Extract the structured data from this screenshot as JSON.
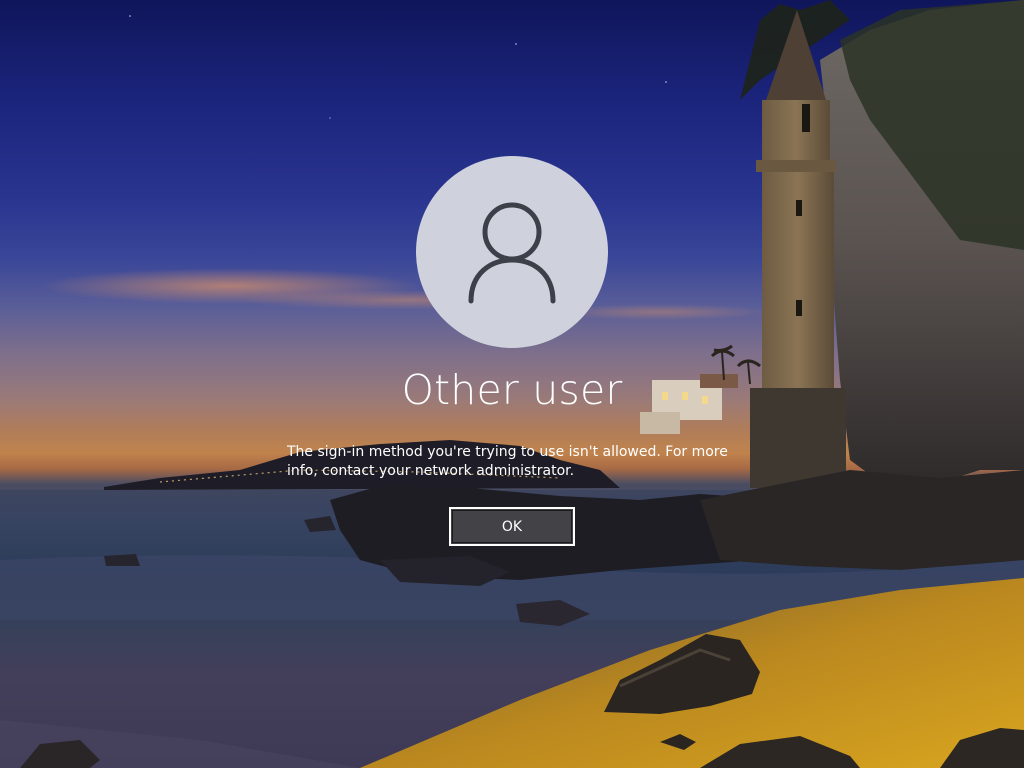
{
  "background": {
    "description_icon": "beach-castle-wallpaper"
  },
  "avatar": {
    "icon": "user-silhouette-icon"
  },
  "user": {
    "name": "Other user"
  },
  "error": {
    "message": "The sign-in method you're trying to use isn't allowed. For more info, contact your network administrator."
  },
  "buttons": {
    "ok_label": "OK"
  },
  "colors": {
    "avatar_bg": "#cfd2dc",
    "avatar_stroke": "#3d4048",
    "text": "#ffffff",
    "button_bg": "#46464b",
    "button_border": "#ffffff"
  }
}
